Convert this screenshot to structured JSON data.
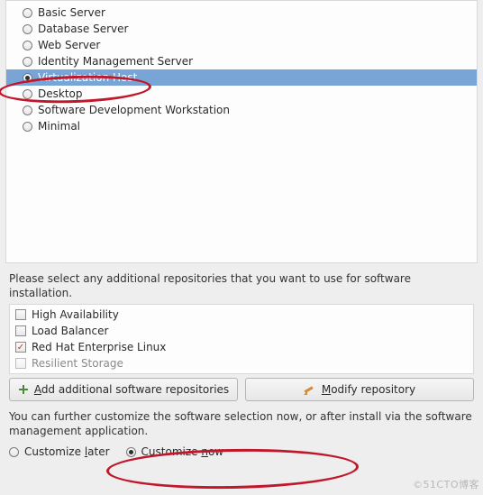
{
  "base_environments": {
    "options": [
      {
        "id": "basic-server",
        "label": "Basic Server",
        "selected": false
      },
      {
        "id": "database-server",
        "label": "Database Server",
        "selected": false
      },
      {
        "id": "web-server",
        "label": "Web Server",
        "selected": false
      },
      {
        "id": "identity-management-server",
        "label": "Identity Management Server",
        "selected": false
      },
      {
        "id": "virtualization-host",
        "label": "Virtualization Host",
        "selected": true
      },
      {
        "id": "desktop",
        "label": "Desktop",
        "selected": false
      },
      {
        "id": "software-development-workstation",
        "label": "Software Development Workstation",
        "selected": false
      },
      {
        "id": "minimal",
        "label": "Minimal",
        "selected": false
      }
    ]
  },
  "repositories": {
    "intro_text": "Please select any additional repositories that you want to use for software installation.",
    "items": [
      {
        "id": "high-availability",
        "label": "High Availability",
        "checked": false
      },
      {
        "id": "load-balancer",
        "label": "Load Balancer",
        "checked": false
      },
      {
        "id": "rhel",
        "label": "Red Hat Enterprise Linux",
        "checked": true
      },
      {
        "id": "resilient-storage",
        "label": "Resilient Storage",
        "checked": false
      }
    ],
    "add_button": {
      "prefix": "A",
      "rest": "dd additional software repositories"
    },
    "modify_button": {
      "prefix": "M",
      "rest": "odify repository"
    }
  },
  "customize": {
    "intro_text": "You can further customize the software selection now, or after install via the software management application.",
    "later": {
      "prefix": "l",
      "pre": "Customize ",
      "rest": "ater"
    },
    "now": {
      "prefix": "n",
      "pre": "Customize ",
      "rest": "ow"
    },
    "selected": "now"
  },
  "watermark": "©51CTO博客"
}
